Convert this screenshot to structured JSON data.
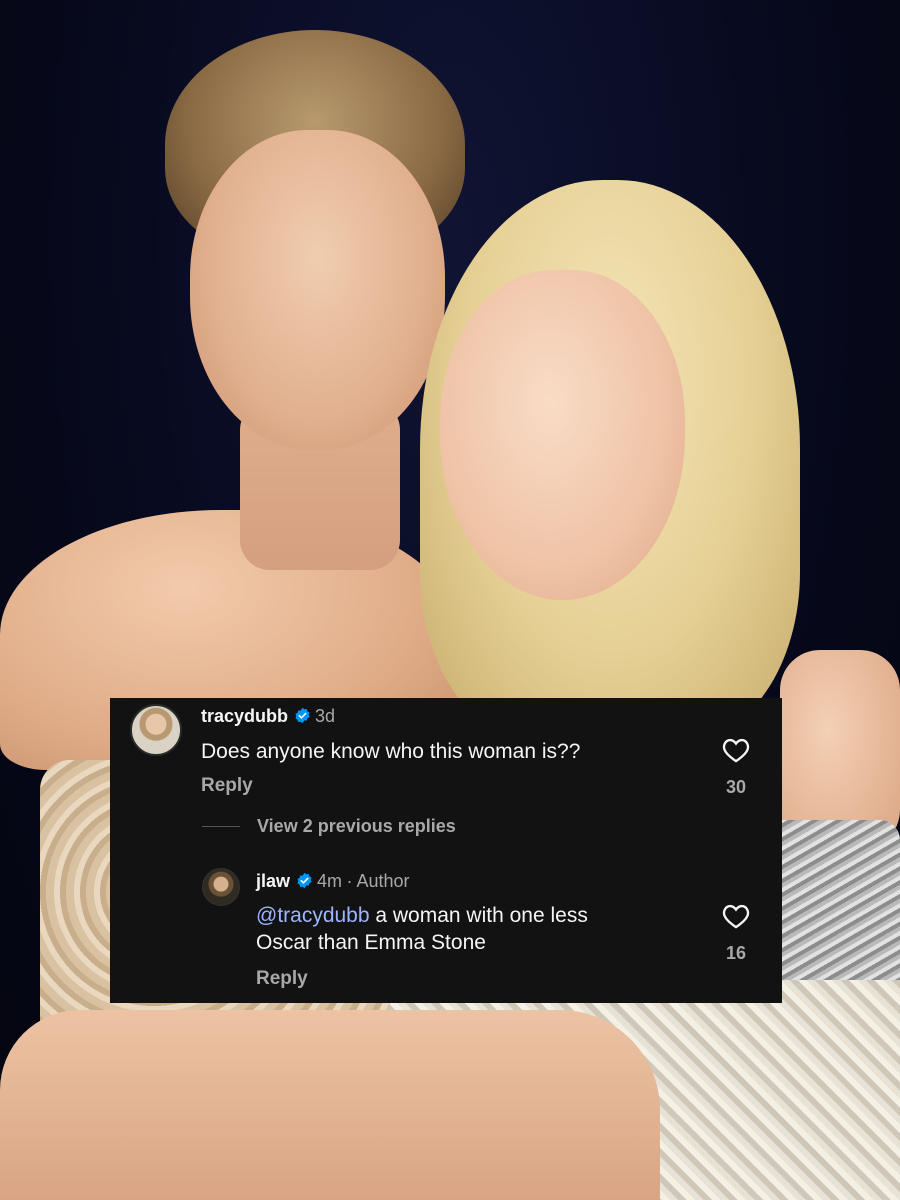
{
  "comments": [
    {
      "username": "tracydubb",
      "time": "3d",
      "text": "Does anyone know who this woman is??",
      "reply_label": "Reply",
      "like_count": "30"
    }
  ],
  "view_replies_label": "View 2 previous replies",
  "reply": {
    "username": "jlaw",
    "time": "4m",
    "author_tag": "· Author",
    "mention": "@tracydubb",
    "text_line1": " a woman with one less",
    "text_line2": "Oscar than Emma Stone",
    "reply_label": "Reply",
    "like_count": "16"
  },
  "colors": {
    "card_bg": "#121212",
    "verified_blue": "#0095f6",
    "mention_blue": "#9db4ff",
    "muted_text": "#a8a8a8"
  },
  "icons": [
    "verified-badge-icon",
    "heart-outline-icon"
  ]
}
